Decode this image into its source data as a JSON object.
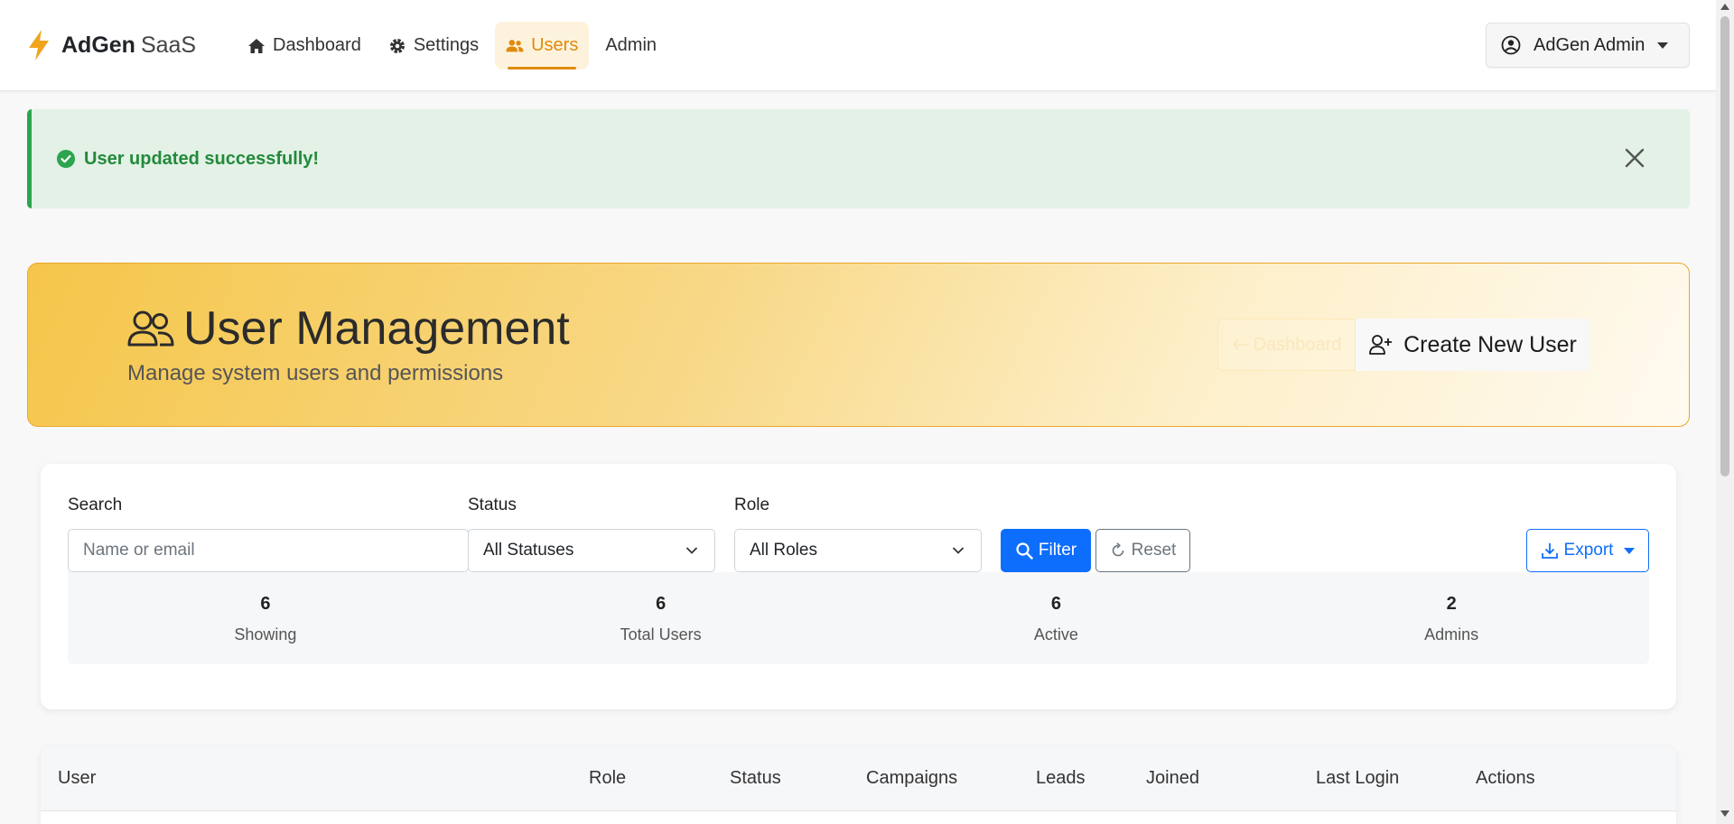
{
  "navbar": {
    "brand_name": "AdGen",
    "brand_sub": "SaaS",
    "items": [
      {
        "label": "Dashboard",
        "icon": "home-icon"
      },
      {
        "label": "Settings",
        "icon": "gear-icon"
      },
      {
        "label": "Users",
        "icon": "users-icon",
        "active": true
      },
      {
        "label": "Admin"
      }
    ],
    "user_menu": "AdGen Admin"
  },
  "alert": {
    "message": "User updated successfully!",
    "color": "#238a3c"
  },
  "hero": {
    "title": "User Management",
    "subtitle": "Manage system users and permissions",
    "dashboard_button": "Dashboard",
    "create_button": "Create New User"
  },
  "filters": {
    "search_label": "Search",
    "search_placeholder": "Name or email",
    "status_label": "Status",
    "status_value": "All Statuses",
    "role_label": "Role",
    "role_value": "All Roles",
    "filter_button": "Filter",
    "reset_button": "Reset",
    "export_button": "Export"
  },
  "stats": [
    {
      "value": "6",
      "label": "Showing"
    },
    {
      "value": "6",
      "label": "Total Users"
    },
    {
      "value": "6",
      "label": "Active"
    },
    {
      "value": "2",
      "label": "Admins"
    }
  ],
  "table": {
    "columns": [
      "User",
      "Role",
      "Status",
      "Campaigns",
      "Leads",
      "Joined",
      "Last Login",
      "Actions"
    ]
  },
  "colors": {
    "accent": "#e08a0c",
    "primary": "#0d6efd",
    "success": "#2da44e"
  }
}
